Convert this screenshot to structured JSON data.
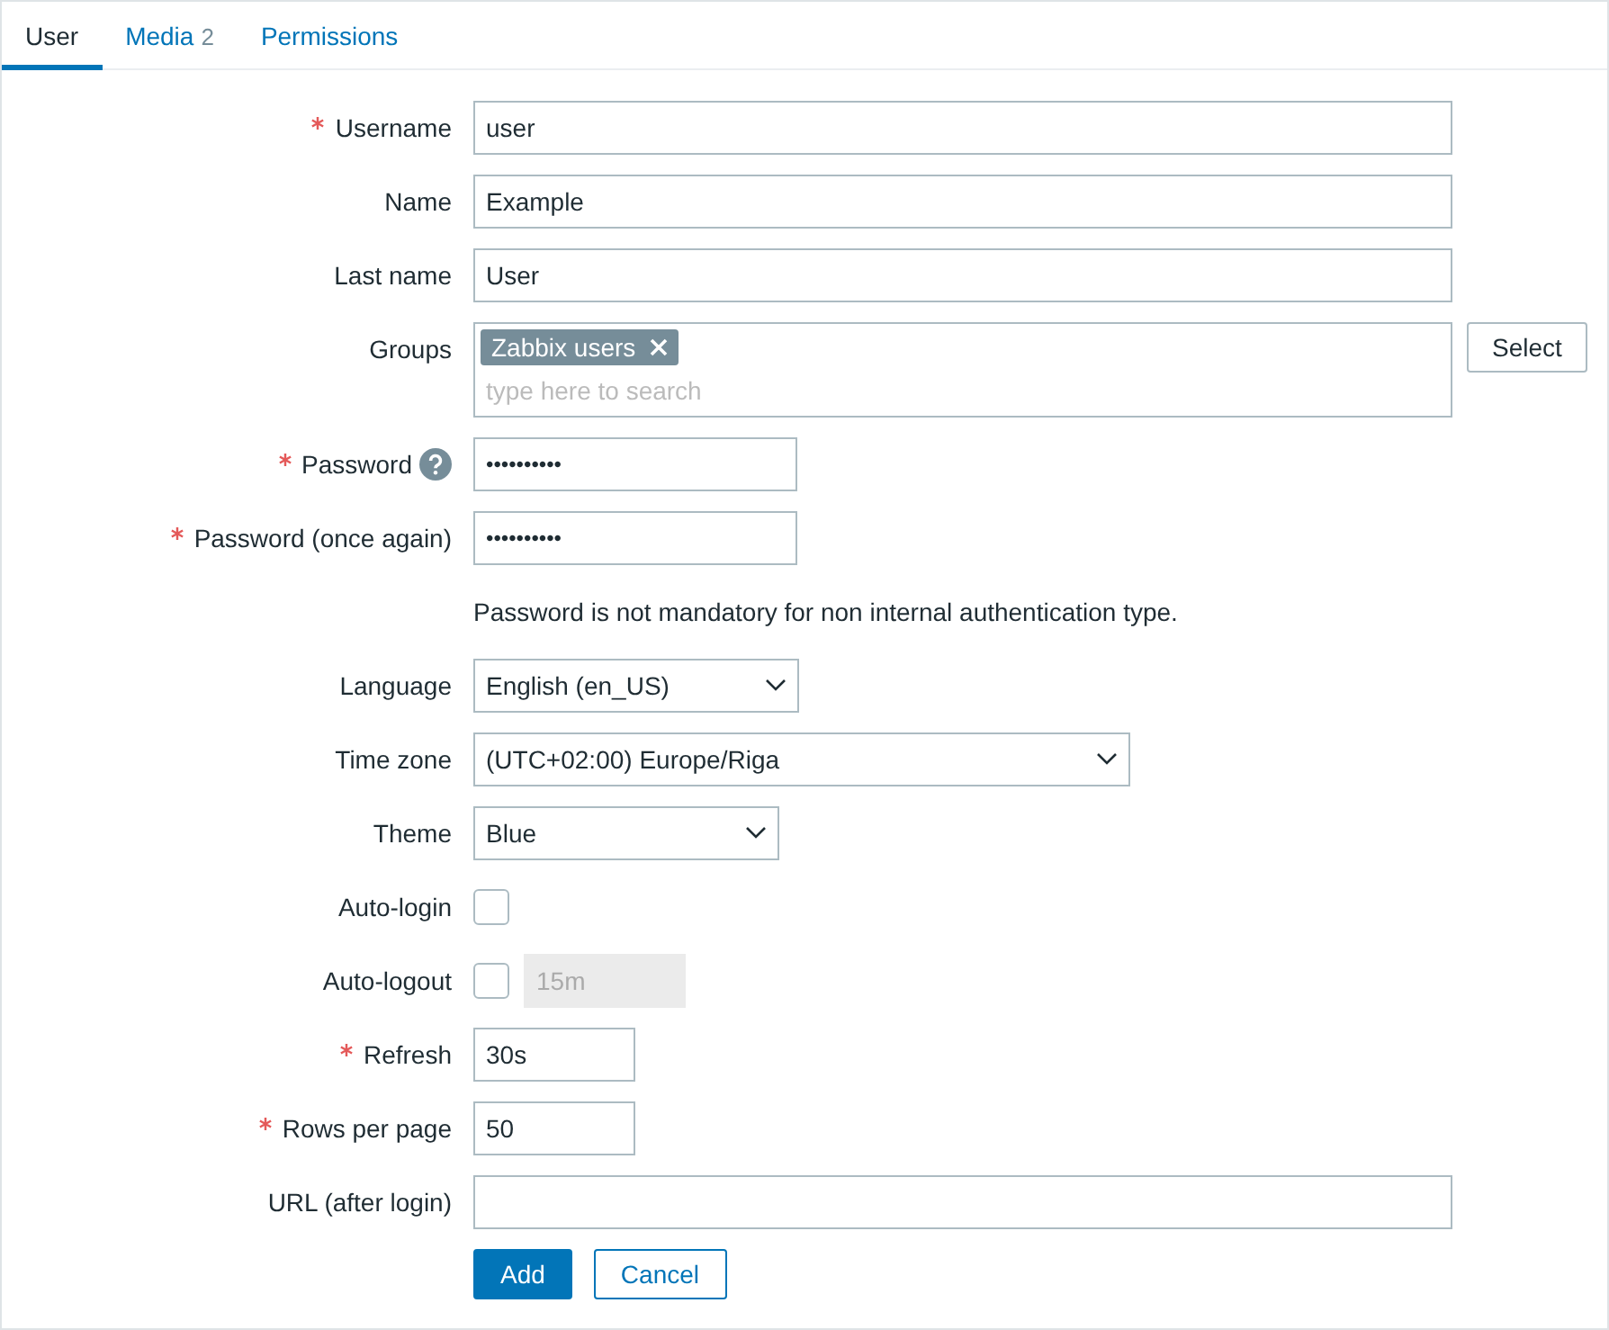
{
  "tabs": [
    {
      "label": "User",
      "selected": true
    },
    {
      "label": "Media",
      "count": "2",
      "selected": false
    },
    {
      "label": "Permissions",
      "selected": false
    }
  ],
  "fields": [
    {
      "kind": "text",
      "label": "Username",
      "required": true,
      "value": "user"
    },
    {
      "kind": "text",
      "label": "Name",
      "required": false,
      "value": "Example"
    },
    {
      "kind": "text",
      "label": "Last name",
      "required": false,
      "value": "User"
    },
    {
      "kind": "groups",
      "label": "Groups",
      "required": false,
      "tags": [
        "Zabbix users"
      ],
      "placeholder": "type here to search",
      "button": "Select"
    },
    {
      "kind": "password",
      "label": "Password",
      "required": true,
      "help": true,
      "value": "••••••••••"
    },
    {
      "kind": "password",
      "label": "Password (once again)",
      "required": true,
      "value": "••••••••••"
    },
    {
      "kind": "note",
      "text": "Password is not mandatory for non internal authentication type."
    },
    {
      "kind": "select",
      "label": "Language",
      "required": false,
      "value": "English (en_US)"
    },
    {
      "kind": "select",
      "label": "Time zone",
      "required": false,
      "value": "(UTC+02:00) Europe/Riga"
    },
    {
      "kind": "select",
      "label": "Theme",
      "required": false,
      "value": "Blue"
    },
    {
      "kind": "checkbox",
      "label": "Auto-login",
      "required": false,
      "checked": false
    },
    {
      "kind": "checkbox",
      "label": "Auto-logout",
      "required": false,
      "checked": false,
      "value": "15m",
      "disabled": true
    },
    {
      "kind": "text",
      "label": "Refresh",
      "required": true,
      "value": "30s"
    },
    {
      "kind": "text",
      "label": "Rows per page",
      "required": true,
      "value": "50"
    },
    {
      "kind": "text",
      "label": "URL (after login)",
      "required": false
    }
  ],
  "buttons": [
    {
      "label": "Add",
      "primary": true
    },
    {
      "label": "Cancel",
      "primary": false
    }
  ]
}
